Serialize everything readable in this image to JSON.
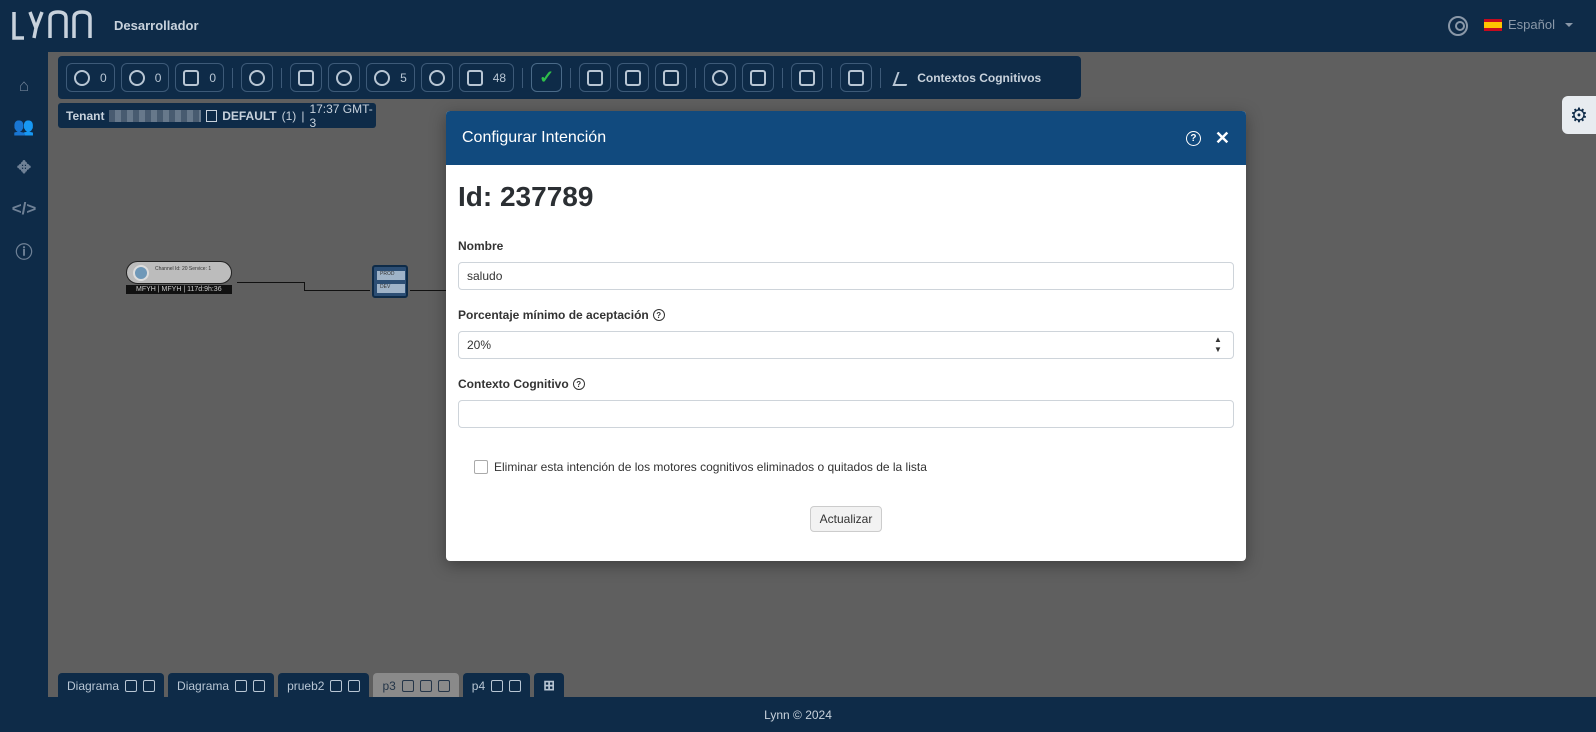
{
  "app": {
    "brand": "LYNN",
    "role": "Desarrollador",
    "language": "Español"
  },
  "sidebar": {
    "items": [
      "home-icon",
      "users-icon",
      "flow-icon",
      "code-icon",
      "info-icon"
    ]
  },
  "toolbar": {
    "agents_count": "0",
    "chats_count": "0",
    "bots_count": "0",
    "search_count": "5",
    "plugins_count": "48",
    "contexts_label": "Contextos Cognitivos"
  },
  "tenant": {
    "label": "Tenant",
    "env": "DEFAULT",
    "count": "(1)",
    "time": "17:37 GMT-3"
  },
  "diagram": {
    "channel_text": "Channel Id: 20 Service: 1",
    "channel_caption": "MFYH | MFYH | 117d:9h:36",
    "prod_label": "PROD",
    "dev_label": "DEV"
  },
  "tabs": [
    {
      "label": "Diagrama"
    },
    {
      "label": "Diagrama"
    },
    {
      "label": "prueb2"
    },
    {
      "label": "p3"
    },
    {
      "label": "p4"
    }
  ],
  "footer": {
    "text": "Lynn © 2024"
  },
  "modal": {
    "title": "Configurar Intención",
    "id_text": "Id: 237789",
    "name_label": "Nombre",
    "name_value": "saludo",
    "percent_label": "Porcentaje mínimo de aceptación",
    "percent_value": "20%",
    "context_label": "Contexto Cognitivo",
    "context_value": "",
    "checkbox_label": "Eliminar esta intención de los motores cognitivos eliminados o quitados de la lista",
    "submit_label": "Actualizar"
  },
  "colors": {
    "navy": "#0e2b48",
    "modal_header": "#114a7e",
    "check_green": "#2fbf4a"
  }
}
